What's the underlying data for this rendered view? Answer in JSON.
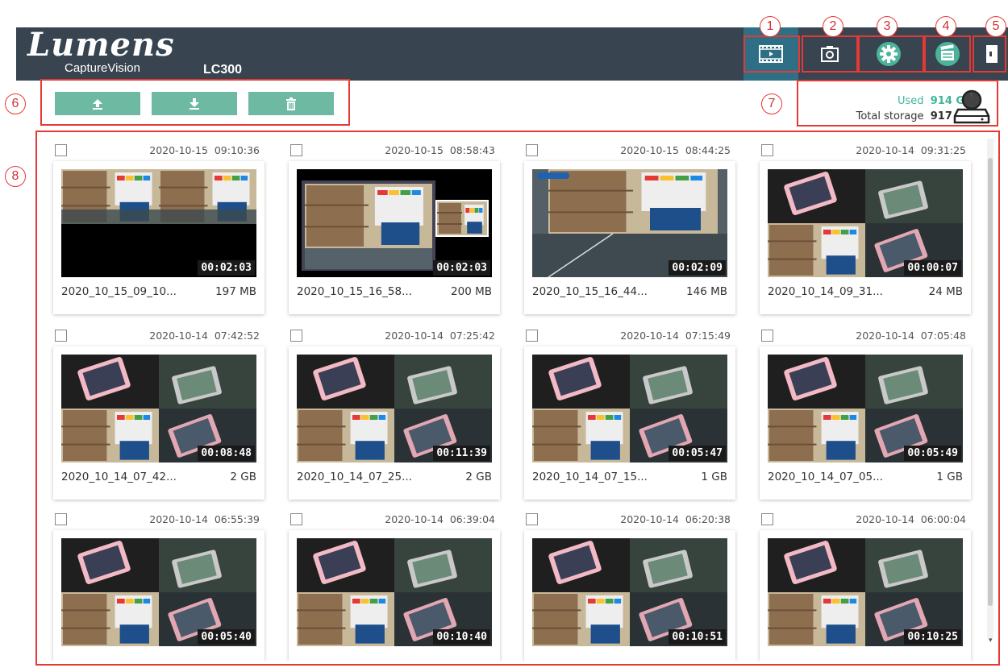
{
  "app": {
    "brand": "Lumens",
    "product": "CaptureVision",
    "model": "LC300"
  },
  "nav": [
    {
      "icon": "filmstrip-icon",
      "active": true
    },
    {
      "icon": "camera-icon",
      "active": false
    },
    {
      "icon": "gear-icon",
      "active": false
    },
    {
      "icon": "clapperboard-icon",
      "active": false
    },
    {
      "icon": "exit-icon",
      "active": false
    }
  ],
  "actions": [
    {
      "icon": "upload-icon"
    },
    {
      "icon": "download-icon"
    },
    {
      "icon": "trash-icon"
    }
  ],
  "storage": {
    "used_label": "Used",
    "used_value": "914 GB",
    "total_label": "Total storage",
    "total_value": "917 GB",
    "used_fraction": 0.997,
    "icon": "hard-drive-icon"
  },
  "callouts": [
    "1",
    "2",
    "3",
    "4",
    "5",
    "6",
    "7",
    "8"
  ],
  "colors": {
    "header": "#384450",
    "active": "#2e6f86",
    "button": "#6db9a2",
    "used": "#3fb59b",
    "callout": "#e53935"
  },
  "recordings": [
    {
      "date": "2020-10-15",
      "time": "09:10:36",
      "duration": "00:02:03",
      "name": "2020_10_15_09_10...",
      "size": "197 MB",
      "scene": "dual"
    },
    {
      "date": "2020-10-15",
      "time": "08:58:43",
      "duration": "00:02:03",
      "name": "2020_10_15_16_58...",
      "size": "200 MB",
      "scene": "pip"
    },
    {
      "date": "2020-10-15",
      "time": "08:44:25",
      "duration": "00:02:09",
      "name": "2020_10_15_16_44...",
      "size": "146 MB",
      "scene": "room"
    },
    {
      "date": "2020-10-14",
      "time": "09:31:25",
      "duration": "00:00:07",
      "name": "2020_10_14_09_31...",
      "size": "24 MB",
      "scene": "quad"
    },
    {
      "date": "2020-10-14",
      "time": "07:42:52",
      "duration": "00:08:48",
      "name": "2020_10_14_07_42...",
      "size": "2 GB",
      "scene": "quad"
    },
    {
      "date": "2020-10-14",
      "time": "07:25:42",
      "duration": "00:11:39",
      "name": "2020_10_14_07_25...",
      "size": "2 GB",
      "scene": "quad"
    },
    {
      "date": "2020-10-14",
      "time": "07:15:49",
      "duration": "00:05:47",
      "name": "2020_10_14_07_15...",
      "size": "1 GB",
      "scene": "quad"
    },
    {
      "date": "2020-10-14",
      "time": "07:05:48",
      "duration": "00:05:49",
      "name": "2020_10_14_07_05...",
      "size": "1 GB",
      "scene": "quad"
    },
    {
      "date": "2020-10-14",
      "time": "06:55:39",
      "duration": "00:05:40",
      "name": "",
      "size": "",
      "scene": "quad"
    },
    {
      "date": "2020-10-14",
      "time": "06:39:04",
      "duration": "00:10:40",
      "name": "",
      "size": "",
      "scene": "quad"
    },
    {
      "date": "2020-10-14",
      "time": "06:20:38",
      "duration": "00:10:51",
      "name": "",
      "size": "",
      "scene": "quad"
    },
    {
      "date": "2020-10-14",
      "time": "06:00:04",
      "duration": "00:10:25",
      "name": "",
      "size": "",
      "scene": "quad"
    }
  ]
}
